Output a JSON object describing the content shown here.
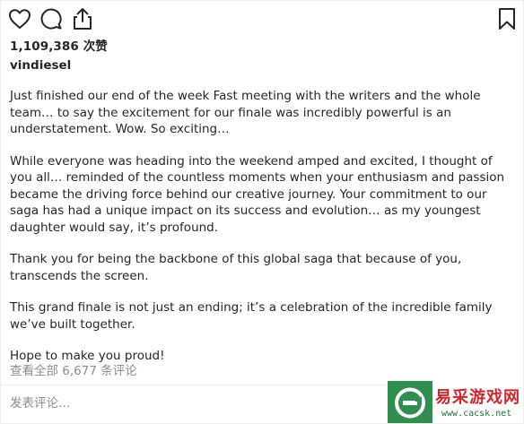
{
  "actions": {
    "icons": [
      "heart-icon",
      "comment-icon",
      "share-icon",
      "bookmark-icon"
    ]
  },
  "post": {
    "likes_text": "1,109,386 次赞",
    "username": "vindiesel",
    "caption": [
      "Just finished our end of the week Fast meeting with the writers and the whole team… to say the excitement for our finale was incredibly powerful is an understatement. Wow. So exciting…",
      "While everyone was heading into the weekend amped and excited, I thought of you all… reminded of the countless moments when your enthusiasm and passion became the driving force behind our creative journey. Your commitment to our saga has had a unique impact on its success and evolution… as my youngest daughter would say, it’s profound.",
      "Thank you for being the backbone of this global saga that because of you, transcends the screen.",
      "This grand finale is not just an ending; it’s a celebration of the incredible family we’ve built together.",
      "Hope to make you proud!"
    ],
    "view_comments_text": "查看全部 6,677 条评论"
  },
  "comment_box": {
    "placeholder": "发表评论…"
  },
  "watermark": {
    "brand": "易采游戏网",
    "url": "www.cacsk.net"
  },
  "colors": {
    "text": "#262626",
    "muted": "#8e8e8e",
    "divider": "#efefef",
    "watermark_green": "#2f8f4e",
    "watermark_red": "#d2262a"
  }
}
